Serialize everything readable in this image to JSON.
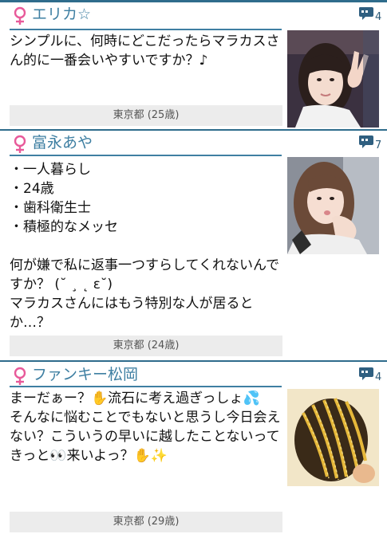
{
  "posts": [
    {
      "name": "エリカ☆",
      "comment_count": "4",
      "message": "シンプルに、何時にどこだったらマラカスさん的に一番会いやすいですか？♪",
      "location": "東京都 (25歳)",
      "photo": "woman-peace-sign-photo"
    },
    {
      "name": "富永あや",
      "comment_count": "7",
      "message": "・一人暮らし\n・24歳\n・歯科衛生士\n・積極的なメッセ\n\n何が嫌で私に返事一つすらしてくれないんですか？ (˘ ¸ ˛ ε˘)\nマラカスさんにはもう特別な人が居るとか…？",
      "location": "東京都 (24歳)",
      "photo": "woman-pout-photo"
    },
    {
      "name": "ファンキー松岡",
      "comment_count": "4",
      "message": "まーだぁー？✋流石に考え過ぎっしょ💦\nそんなに悩むことでもないと思うし今日会えない？こういうの早いに越したことないってきっと👀来いよっ？✋✨",
      "location": "東京都 (29歳)",
      "photo": "braided-hair-photo"
    }
  ],
  "colors": {
    "accent": "#3e7fa2",
    "divider": "#2f6c8c",
    "female_icon": "#e85a9a",
    "location_bg": "#ececec"
  },
  "icons": {
    "gender": "female-icon",
    "comments": "comment-icon"
  }
}
